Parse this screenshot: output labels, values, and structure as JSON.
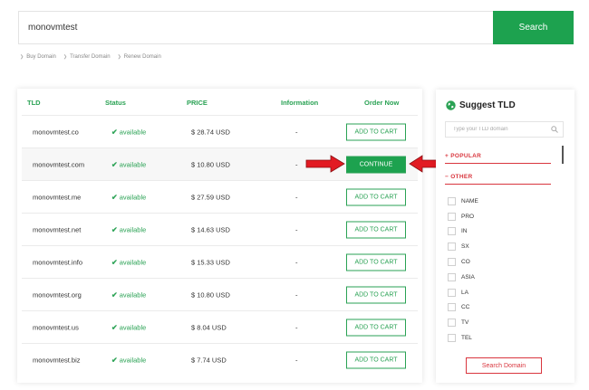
{
  "search": {
    "value": "monovmtest",
    "button_label": "Search"
  },
  "sublinks": [
    "Buy Domain",
    "Transfer Domain",
    "Renew Domain"
  ],
  "table": {
    "headers": {
      "tld": "TLD",
      "status": "Status",
      "price": "PRICE",
      "information": "Information",
      "order": "Order Now"
    },
    "rows": [
      {
        "domain": "monovmtest.co",
        "status": "available",
        "price": "$ 28.74 USD",
        "info": "-",
        "action": "ADD TO CART",
        "highlight": false
      },
      {
        "domain": "monovmtest.com",
        "status": "available",
        "price": "$ 10.80 USD",
        "info": "-",
        "action": "CONTINUE",
        "highlight": true
      },
      {
        "domain": "monovmtest.me",
        "status": "available",
        "price": "$ 27.59 USD",
        "info": "-",
        "action": "ADD TO CART",
        "highlight": false
      },
      {
        "domain": "monovmtest.net",
        "status": "available",
        "price": "$ 14.63 USD",
        "info": "-",
        "action": "ADD TO CART",
        "highlight": false
      },
      {
        "domain": "monovmtest.info",
        "status": "available",
        "price": "$ 15.33 USD",
        "info": "-",
        "action": "ADD TO CART",
        "highlight": false
      },
      {
        "domain": "monovmtest.org",
        "status": "available",
        "price": "$ 10.80 USD",
        "info": "-",
        "action": "ADD TO CART",
        "highlight": false
      },
      {
        "domain": "monovmtest.us",
        "status": "available",
        "price": "$ 8.04 USD",
        "info": "-",
        "action": "ADD TO CART",
        "highlight": false
      },
      {
        "domain": "monovmtest.biz",
        "status": "available",
        "price": "$ 7.74 USD",
        "info": "-",
        "action": "ADD TO CART",
        "highlight": false
      }
    ]
  },
  "suggest": {
    "title": "Suggest TLD",
    "placeholder": "Type your TLD domain",
    "popular_label": "+ POPULAR",
    "other_label": "− OTHER",
    "tlds": [
      "NAME",
      "PRO",
      "IN",
      "SX",
      "CO",
      "ASIA",
      "LA",
      "CC",
      "TV",
      "TEL"
    ],
    "button_label": "Search Domain"
  },
  "colors": {
    "accent": "#1da24f",
    "alert": "#d9363e"
  },
  "icons": {
    "status": "check-icon",
    "panel_title": "globe-icon",
    "tld_search": "magnifier-icon",
    "pointer": "red-arrow-icon"
  }
}
